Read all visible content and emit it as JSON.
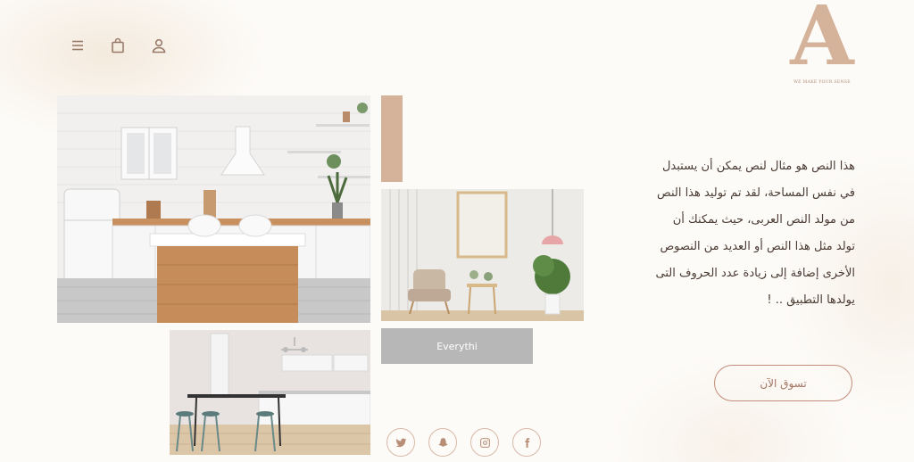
{
  "header": {
    "icons": [
      "menu-icon",
      "bag-icon",
      "user-icon"
    ]
  },
  "logo": {
    "letter": "A",
    "tagline": "WE MAKE YOUR SENSE"
  },
  "gallery": {
    "button_label": "Everythi"
  },
  "content": {
    "paragraph": "هذا النص هو مثال لنص يمكن أن يستبدل في نفس المساحة، لقد تم توليد هذا النص من مولد النص العربى، حيث يمكنك أن تولد مثل هذا النص أو العديد من النصوص الأخرى إضافة إلى زيادة عدد الحروف التى يولدها التطبيق .. !",
    "shop_button": "تسوق الآن"
  },
  "social": [
    "twitter-icon",
    "snapchat-icon",
    "instagram-icon",
    "facebook-icon"
  ],
  "colors": {
    "accent": "#d4b39a",
    "text": "#4a3b33",
    "button_grey": "#b7b7b7",
    "outline": "#c28d7a"
  }
}
